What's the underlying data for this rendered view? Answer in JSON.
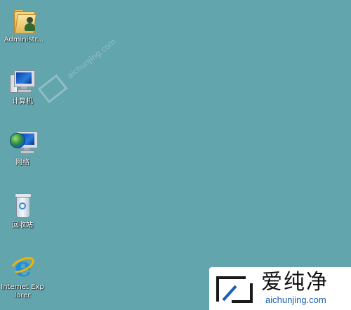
{
  "desktop": {
    "background_color": "#63a5ad",
    "icons": [
      {
        "label": "Administr...",
        "icon": "user-folder-icon"
      },
      {
        "label": "计算机",
        "icon": "computer-icon"
      },
      {
        "label": "网络",
        "icon": "network-icon"
      },
      {
        "label": "回收站",
        "icon": "recycle-bin-icon"
      },
      {
        "label": "Internet Explorer",
        "icon": "internet-explorer-icon"
      }
    ]
  },
  "watermark": {
    "text": "aichunjing.com"
  },
  "logo": {
    "chinese_text": "爱纯净",
    "url_text": "aichunjing.com",
    "url_color": "#1a5fb0"
  }
}
